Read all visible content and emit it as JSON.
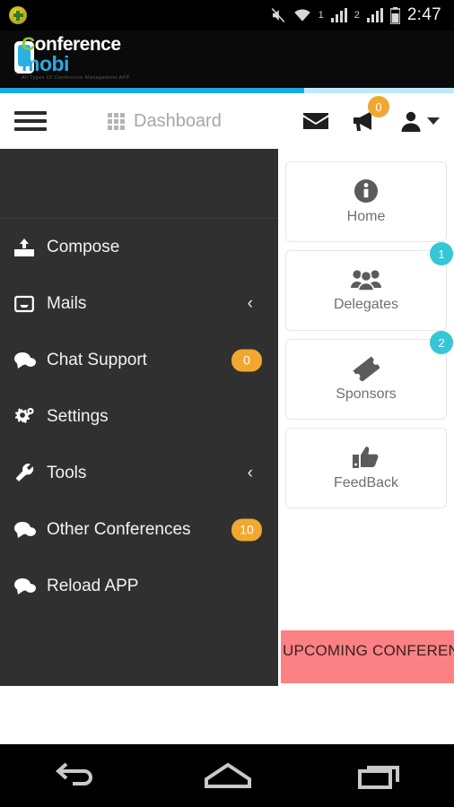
{
  "statusbar": {
    "time": "2:47",
    "sim1_label": "1",
    "sim2_label": "2",
    "icons": [
      "notification-dot-icon",
      "mute-icon",
      "wifi-icon",
      "signal-icon",
      "signal-icon",
      "battery-icon"
    ]
  },
  "brand": {
    "word1_accent": "C",
    "word1_rest": "onference",
    "word2": "mobi",
    "tagline": "All Types Of Conference Management APP"
  },
  "progress": {
    "percent": 67,
    "fill_color": "#1ba8e0",
    "track_color": "#bfe9f9"
  },
  "navbar": {
    "title": "Dashboard",
    "menu_icon": "hamburger-icon",
    "grid_icon": "grid-icon",
    "mail_icon": "envelope-icon",
    "announce_icon": "megaphone-icon",
    "announce_badge": "0",
    "user_icon": "user-icon",
    "caret_icon": "chevron-down-icon"
  },
  "drawer": {
    "background": "#303030",
    "items": [
      {
        "label": "Compose",
        "icon": "upload-icon",
        "badge": null,
        "chevron": false
      },
      {
        "label": "Mails",
        "icon": "inbox-icon",
        "badge": null,
        "chevron": true
      },
      {
        "label": "Chat Support",
        "icon": "comments-icon",
        "badge": "0",
        "chevron": false
      },
      {
        "label": "Settings",
        "icon": "gears-icon",
        "badge": null,
        "chevron": false
      },
      {
        "label": "Tools",
        "icon": "wrench-icon",
        "badge": null,
        "chevron": true
      },
      {
        "label": "Other Conferences",
        "icon": "comments-icon",
        "badge": "10",
        "chevron": false
      },
      {
        "label": "Reload APP",
        "icon": "comments-icon",
        "badge": null,
        "chevron": false
      }
    ],
    "badge_color": "#f0a830"
  },
  "content": {
    "cards": [
      {
        "label": "Home",
        "icon": "info-circle-icon",
        "badge": null
      },
      {
        "label": "Delegates",
        "icon": "group-icon",
        "badge": "1"
      },
      {
        "label": "Sponsors",
        "icon": "ticket-icon",
        "badge": "2"
      },
      {
        "label": "FeedBack",
        "icon": "thumbs-up-icon",
        "badge": null
      }
    ],
    "badge_color": "#35c7d6"
  },
  "banner": {
    "text": "UPCOMING CONFERENCES",
    "background": "#fb8184"
  },
  "androidnav": {
    "back_icon": "back-arrow-icon",
    "home_icon": "home-icon",
    "recents_icon": "recents-icon"
  }
}
